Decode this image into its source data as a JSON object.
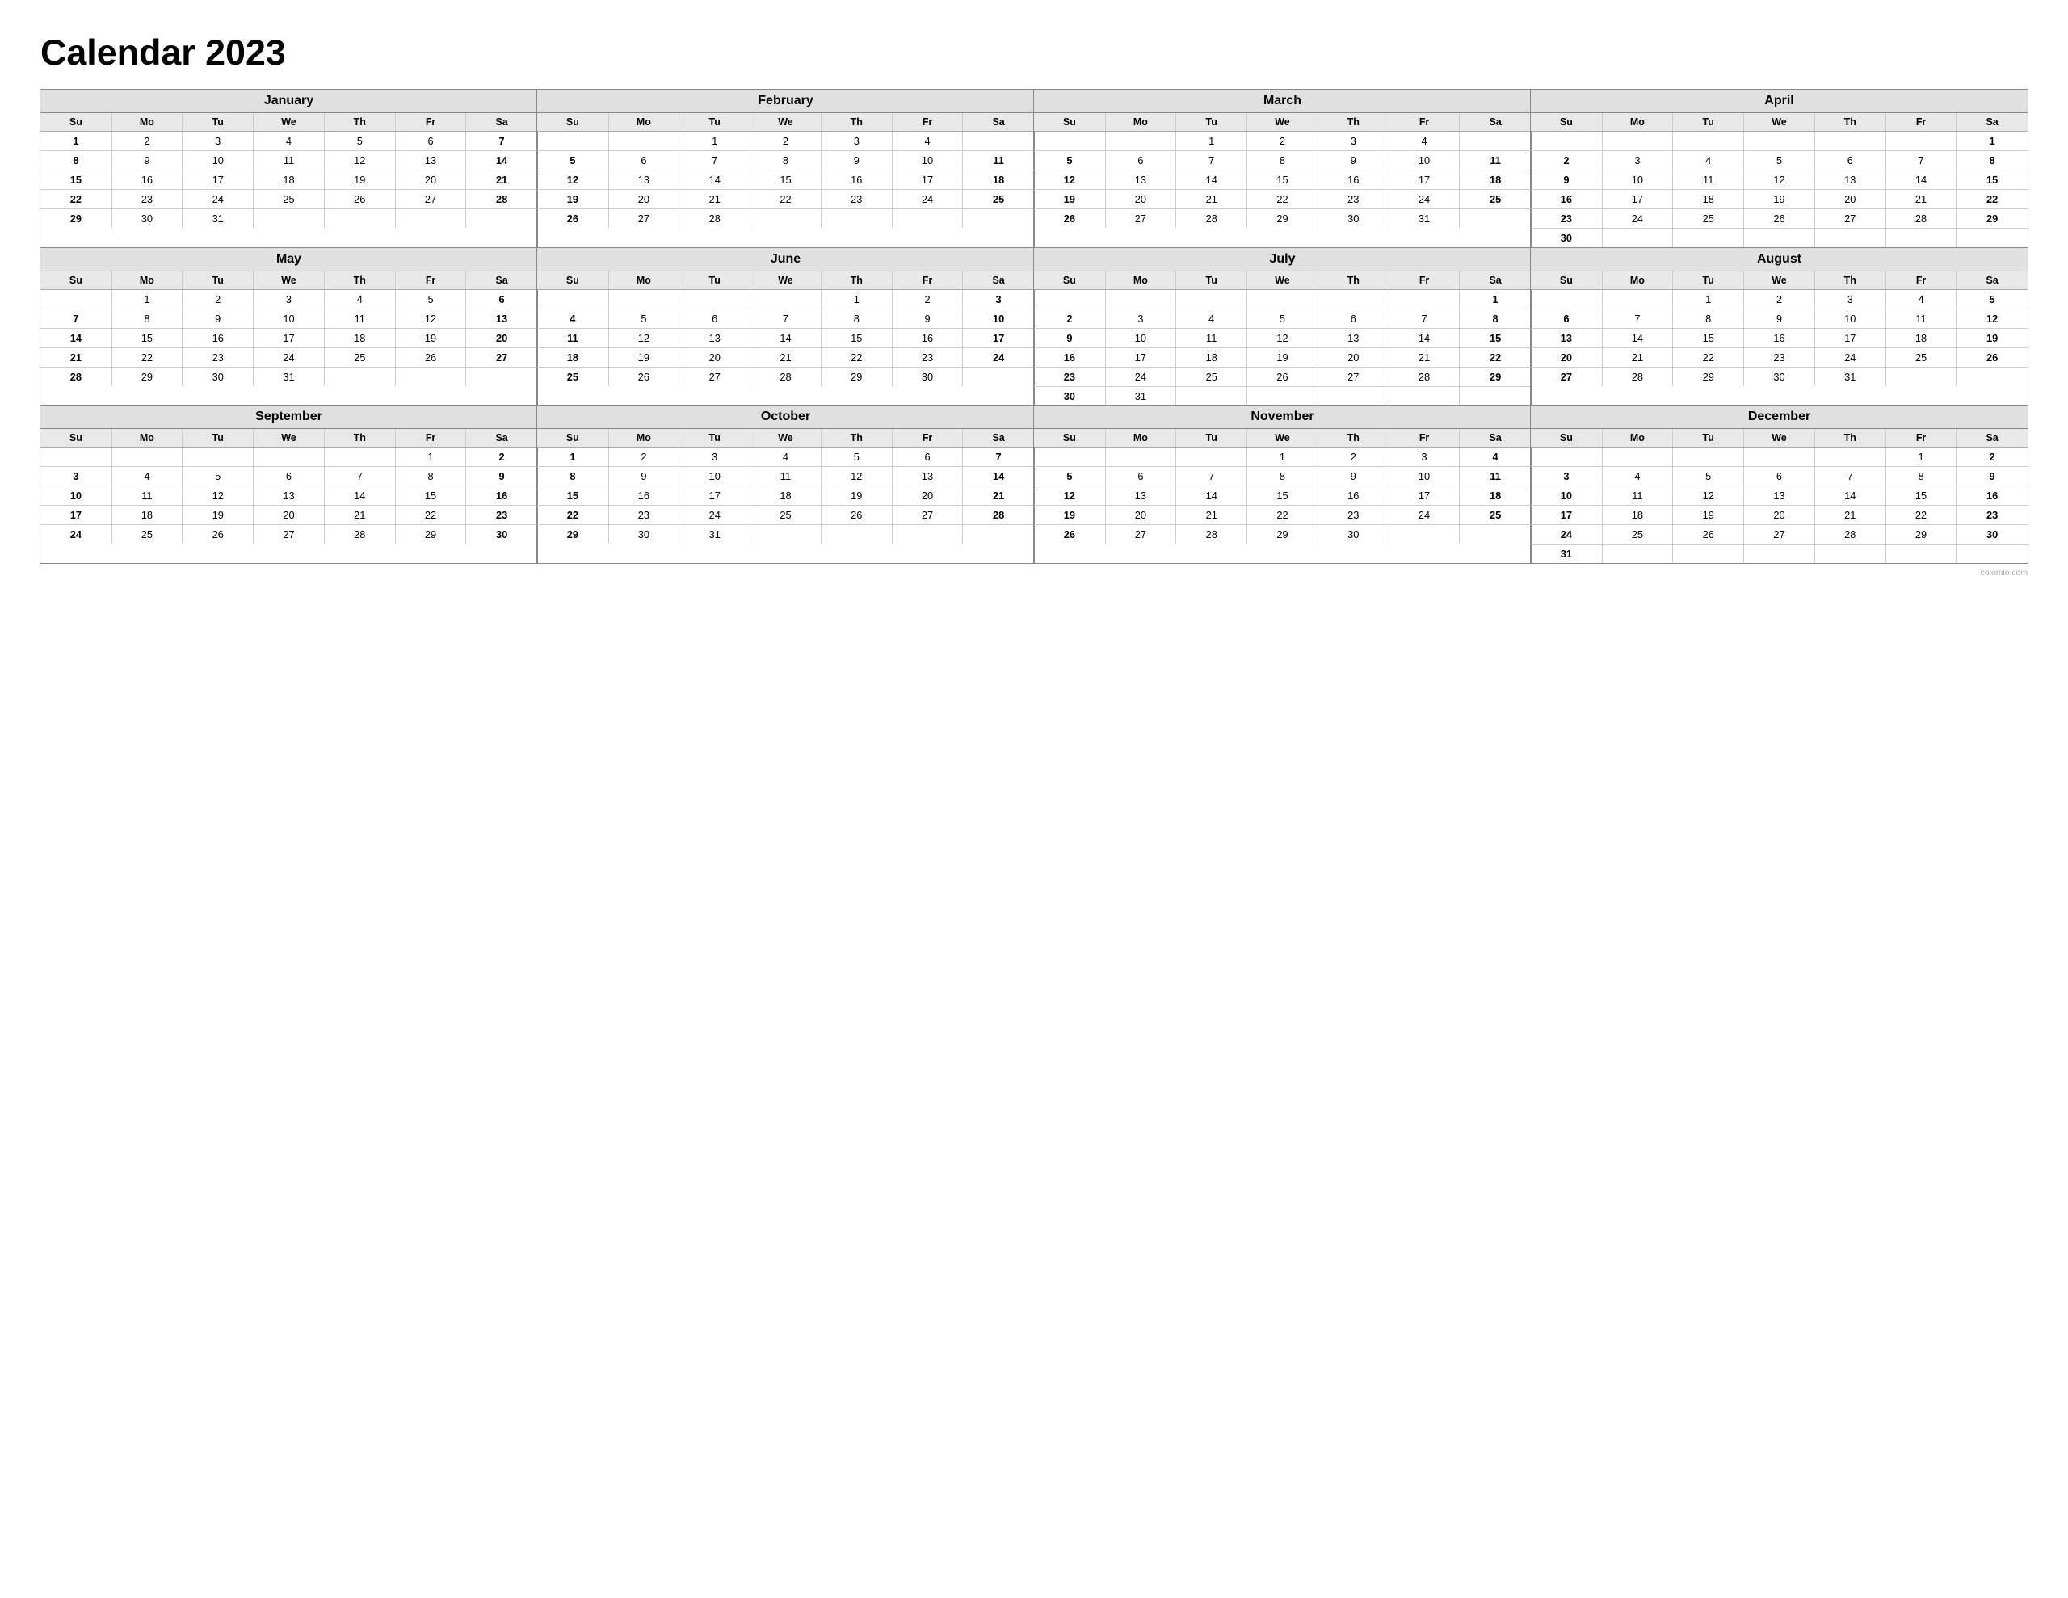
{
  "title": "Calendar 2023",
  "months": [
    {
      "name": "January",
      "weeks": [
        [
          "1",
          "2",
          "3",
          "4",
          "5",
          "6",
          "7"
        ],
        [
          "8",
          "9",
          "10",
          "11",
          "12",
          "13",
          "14"
        ],
        [
          "15",
          "16",
          "17",
          "18",
          "19",
          "20",
          "21"
        ],
        [
          "22",
          "23",
          "24",
          "25",
          "26",
          "27",
          "28"
        ],
        [
          "29",
          "30",
          "31",
          "",
          "",
          "",
          ""
        ]
      ]
    },
    {
      "name": "February",
      "weeks": [
        [
          "",
          "",
          "1",
          "2",
          "3",
          "4",
          ""
        ],
        [
          "5",
          "6",
          "7",
          "8",
          "9",
          "10",
          "11"
        ],
        [
          "12",
          "13",
          "14",
          "15",
          "16",
          "17",
          "18"
        ],
        [
          "19",
          "20",
          "21",
          "22",
          "23",
          "24",
          "25"
        ],
        [
          "26",
          "27",
          "28",
          "",
          "",
          "",
          ""
        ]
      ]
    },
    {
      "name": "March",
      "weeks": [
        [
          "",
          "",
          "1",
          "2",
          "3",
          "4",
          ""
        ],
        [
          "5",
          "6",
          "7",
          "8",
          "9",
          "10",
          "11"
        ],
        [
          "12",
          "13",
          "14",
          "15",
          "16",
          "17",
          "18"
        ],
        [
          "19",
          "20",
          "21",
          "22",
          "23",
          "24",
          "25"
        ],
        [
          "26",
          "27",
          "28",
          "29",
          "30",
          "31",
          ""
        ]
      ]
    },
    {
      "name": "April",
      "weeks": [
        [
          "",
          "",
          "",
          "",
          "",
          "",
          "1"
        ],
        [
          "2",
          "3",
          "4",
          "5",
          "6",
          "7",
          "8"
        ],
        [
          "9",
          "10",
          "11",
          "12",
          "13",
          "14",
          "15"
        ],
        [
          "16",
          "17",
          "18",
          "19",
          "20",
          "21",
          "22"
        ],
        [
          "23",
          "24",
          "25",
          "26",
          "27",
          "28",
          "29"
        ],
        [
          "30",
          "",
          "",
          "",
          "",
          "",
          ""
        ]
      ]
    },
    {
      "name": "May",
      "weeks": [
        [
          "",
          "1",
          "2",
          "3",
          "4",
          "5",
          "6"
        ],
        [
          "7",
          "8",
          "9",
          "10",
          "11",
          "12",
          "13"
        ],
        [
          "14",
          "15",
          "16",
          "17",
          "18",
          "19",
          "20"
        ],
        [
          "21",
          "22",
          "23",
          "24",
          "25",
          "26",
          "27"
        ],
        [
          "28",
          "29",
          "30",
          "31",
          "",
          "",
          ""
        ]
      ]
    },
    {
      "name": "June",
      "weeks": [
        [
          "",
          "",
          "",
          "",
          "1",
          "2",
          "3"
        ],
        [
          "4",
          "5",
          "6",
          "7",
          "8",
          "9",
          "10"
        ],
        [
          "11",
          "12",
          "13",
          "14",
          "15",
          "16",
          "17"
        ],
        [
          "18",
          "19",
          "20",
          "21",
          "22",
          "23",
          "24"
        ],
        [
          "25",
          "26",
          "27",
          "28",
          "29",
          "30",
          ""
        ]
      ]
    },
    {
      "name": "July",
      "weeks": [
        [
          "",
          "",
          "",
          "",
          "",
          "",
          "1"
        ],
        [
          "2",
          "3",
          "4",
          "5",
          "6",
          "7",
          "8"
        ],
        [
          "9",
          "10",
          "11",
          "12",
          "13",
          "14",
          "15"
        ],
        [
          "16",
          "17",
          "18",
          "19",
          "20",
          "21",
          "22"
        ],
        [
          "23",
          "24",
          "25",
          "26",
          "27",
          "28",
          "29"
        ],
        [
          "30",
          "31",
          "",
          "",
          "",
          "",
          ""
        ]
      ]
    },
    {
      "name": "August",
      "weeks": [
        [
          "",
          "",
          "1",
          "2",
          "3",
          "4",
          "5"
        ],
        [
          "6",
          "7",
          "8",
          "9",
          "10",
          "11",
          "12"
        ],
        [
          "13",
          "14",
          "15",
          "16",
          "17",
          "18",
          "19"
        ],
        [
          "20",
          "21",
          "22",
          "23",
          "24",
          "25",
          "26"
        ],
        [
          "27",
          "28",
          "29",
          "30",
          "31",
          "",
          ""
        ]
      ]
    },
    {
      "name": "September",
      "weeks": [
        [
          "",
          "",
          "",
          "",
          "",
          "1",
          "2"
        ],
        [
          "3",
          "4",
          "5",
          "6",
          "7",
          "8",
          "9"
        ],
        [
          "10",
          "11",
          "12",
          "13",
          "14",
          "15",
          "16"
        ],
        [
          "17",
          "18",
          "19",
          "20",
          "21",
          "22",
          "23"
        ],
        [
          "24",
          "25",
          "26",
          "27",
          "28",
          "29",
          "30"
        ]
      ]
    },
    {
      "name": "October",
      "weeks": [
        [
          "1",
          "2",
          "3",
          "4",
          "5",
          "6",
          "7"
        ],
        [
          "8",
          "9",
          "10",
          "11",
          "12",
          "13",
          "14"
        ],
        [
          "15",
          "16",
          "17",
          "18",
          "19",
          "20",
          "21"
        ],
        [
          "22",
          "23",
          "24",
          "25",
          "26",
          "27",
          "28"
        ],
        [
          "29",
          "30",
          "31",
          "",
          "",
          "",
          ""
        ]
      ]
    },
    {
      "name": "November",
      "weeks": [
        [
          "",
          "",
          "",
          "1",
          "2",
          "3",
          "4"
        ],
        [
          "5",
          "6",
          "7",
          "8",
          "9",
          "10",
          "11"
        ],
        [
          "12",
          "13",
          "14",
          "15",
          "16",
          "17",
          "18"
        ],
        [
          "19",
          "20",
          "21",
          "22",
          "23",
          "24",
          "25"
        ],
        [
          "26",
          "27",
          "28",
          "29",
          "30",
          "",
          ""
        ]
      ]
    },
    {
      "name": "December",
      "weeks": [
        [
          "",
          "",
          "",
          "",
          "",
          "1",
          "2"
        ],
        [
          "3",
          "4",
          "5",
          "6",
          "7",
          "8",
          "9"
        ],
        [
          "10",
          "11",
          "12",
          "13",
          "14",
          "15",
          "16"
        ],
        [
          "17",
          "18",
          "19",
          "20",
          "21",
          "22",
          "23"
        ],
        [
          "24",
          "25",
          "26",
          "27",
          "28",
          "29",
          "30"
        ],
        [
          "31",
          "",
          "",
          "",
          "",
          "",
          ""
        ]
      ]
    }
  ],
  "days": [
    "Su",
    "Mo",
    "Tu",
    "We",
    "Th",
    "Fr",
    "Sa"
  ],
  "watermark": "colomio.com"
}
